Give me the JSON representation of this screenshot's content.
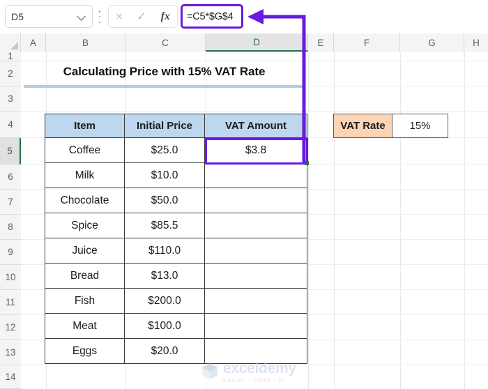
{
  "app": {
    "name": "Microsoft Excel"
  },
  "formula_bar": {
    "name_box_value": "D5",
    "name_box_dropdown_icon": "chevron-down-icon",
    "cancel_icon": "×",
    "confirm_icon": "✓",
    "function_icon": "fx",
    "formula": "=C5*$G$4",
    "highlight_color": "#6a19e0"
  },
  "grid": {
    "column_headers": [
      "A",
      "B",
      "C",
      "D",
      "E",
      "F",
      "G",
      "H"
    ],
    "selected_column": "D",
    "row_headers": [
      "1",
      "2",
      "3",
      "4",
      "5",
      "6",
      "7",
      "8",
      "9",
      "10",
      "11",
      "12",
      "13",
      "14"
    ],
    "selected_row": "5",
    "selected_cell": "D5"
  },
  "sheet": {
    "title": "Calculating Price with 15% VAT Rate",
    "title_rule_color": "#b4cde4",
    "table": {
      "headers": [
        "Item",
        "Initial Price",
        "VAT Amount"
      ],
      "header_fill": "#bdd7ee",
      "rows": [
        {
          "item": "Coffee",
          "price": "$25.0",
          "vat": "$3.8"
        },
        {
          "item": "Milk",
          "price": "$10.0",
          "vat": ""
        },
        {
          "item": "Chocolate",
          "price": "$50.0",
          "vat": ""
        },
        {
          "item": "Spice",
          "price": "$85.5",
          "vat": ""
        },
        {
          "item": "Juice",
          "price": "$110.0",
          "vat": ""
        },
        {
          "item": "Bread",
          "price": "$13.0",
          "vat": ""
        },
        {
          "item": "Fish",
          "price": "$200.0",
          "vat": ""
        },
        {
          "item": "Meat",
          "price": "$100.0",
          "vat": ""
        },
        {
          "item": "Eggs",
          "price": "$20.0",
          "vat": ""
        }
      ]
    },
    "vat_rate": {
      "label": "VAT Rate",
      "value": "15%",
      "label_fill": "#fbd5b5"
    }
  },
  "annotation": {
    "arrow_color": "#6a19e0",
    "arrow_icon": "left-arrow-icon",
    "describes": "D5"
  },
  "watermark": {
    "name": "exceldemy",
    "tagline": "EXCEL - DATA - BI",
    "logo_icon": "cube-logo-icon"
  }
}
